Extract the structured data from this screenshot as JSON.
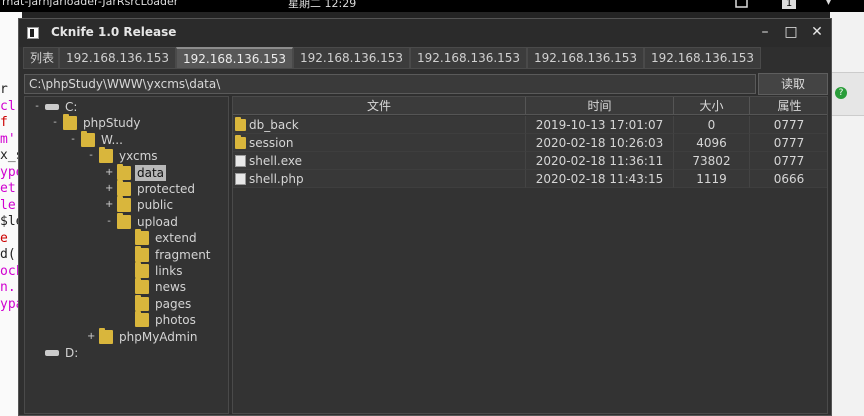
{
  "topbar": {
    "left_text": "rhat-jarhjarloader-JarRsrcLoader",
    "clock": "星期二 12:29",
    "badge": "1"
  },
  "terminal_lines": [
    {
      "text": "r",
      "color": "#222"
    },
    {
      "text": "cl",
      "color": "#d000d0"
    },
    {
      "text": "f (",
      "color": "#c00"
    },
    {
      "text": "m'",
      "color": "#d000d0"
    },
    {
      "text": "x_s",
      "color": "#222"
    },
    {
      "text": "ype",
      "color": "#d000d0"
    },
    {
      "text": "et'",
      "color": "#d000d0"
    },
    {
      "text": "le",
      "color": "#d000d0"
    },
    {
      "text": "$le",
      "color": "#222"
    },
    {
      "text": "e",
      "color": "#c00"
    },
    {
      "text": "d(",
      "color": "#222"
    },
    {
      "text": "ock",
      "color": "#d000d0"
    },
    {
      "text": "n.",
      "color": "#d000d0"
    },
    {
      "text": "ypa",
      "color": "#d000d0"
    }
  ],
  "window": {
    "title": "Cknife 1.0 Release",
    "controls": {
      "minimize": "–",
      "maximize": "□",
      "close": "✕"
    }
  },
  "tabs": [
    {
      "label": "列表",
      "active": false
    },
    {
      "label": "192.168.136.153",
      "active": false
    },
    {
      "label": "192.168.136.153",
      "active": true
    },
    {
      "label": "192.168.136.153",
      "active": false
    },
    {
      "label": "192.168.136.153",
      "active": false
    },
    {
      "label": "192.168.136.153",
      "active": false
    },
    {
      "label": "192.168.136.153",
      "active": false
    }
  ],
  "path": {
    "value": "C:\\phpStudy\\WWW\\yxcms\\data\\",
    "read_button": "读取"
  },
  "tree": [
    {
      "label": "C:",
      "type": "drive",
      "expander": "-",
      "depth": 0
    },
    {
      "label": "phpStudy",
      "type": "folder",
      "expander": "-",
      "depth": 1
    },
    {
      "label": "W...",
      "type": "folder",
      "expander": "-",
      "depth": 2
    },
    {
      "label": "yxcms",
      "type": "folder",
      "expander": "-",
      "depth": 3
    },
    {
      "label": "data",
      "type": "folder",
      "expander": "+",
      "depth": 4,
      "selected": true
    },
    {
      "label": "protected",
      "type": "folder",
      "expander": "+",
      "depth": 4
    },
    {
      "label": "public",
      "type": "folder",
      "expander": "+",
      "depth": 4
    },
    {
      "label": "upload",
      "type": "folder",
      "expander": "-",
      "depth": 4
    },
    {
      "label": "extend",
      "type": "folder",
      "expander": "",
      "depth": 5
    },
    {
      "label": "fragment",
      "type": "folder",
      "expander": "",
      "depth": 5
    },
    {
      "label": "links",
      "type": "folder",
      "expander": "",
      "depth": 5
    },
    {
      "label": "news",
      "type": "folder",
      "expander": "",
      "depth": 5
    },
    {
      "label": "pages",
      "type": "folder",
      "expander": "",
      "depth": 5
    },
    {
      "label": "photos",
      "type": "folder",
      "expander": "",
      "depth": 5
    },
    {
      "label": "phpMyAdmin",
      "type": "folder",
      "expander": "+",
      "depth": 3
    },
    {
      "label": "D:",
      "type": "drive",
      "expander": "",
      "depth": 0
    }
  ],
  "files": {
    "headers": {
      "name": "文件",
      "time": "时间",
      "size": "大小",
      "attr": "属性"
    },
    "rows": [
      {
        "name": "db_back",
        "type": "folder",
        "time": "2019-10-13 17:01:07",
        "size": "0",
        "attr": "0777"
      },
      {
        "name": "session",
        "type": "folder",
        "time": "2020-02-18 10:26:03",
        "size": "4096",
        "attr": "0777"
      },
      {
        "name": "shell.exe",
        "type": "file",
        "time": "2020-02-18 11:36:11",
        "size": "73802",
        "attr": "0777"
      },
      {
        "name": "shell.php",
        "type": "file",
        "time": "2020-02-18 11:43:15",
        "size": "1119",
        "attr": "0666"
      }
    ]
  },
  "colors": {
    "folder": "#d9b63c",
    "window_bg": "#2f2f2f",
    "selection": "#b8b8b8"
  }
}
